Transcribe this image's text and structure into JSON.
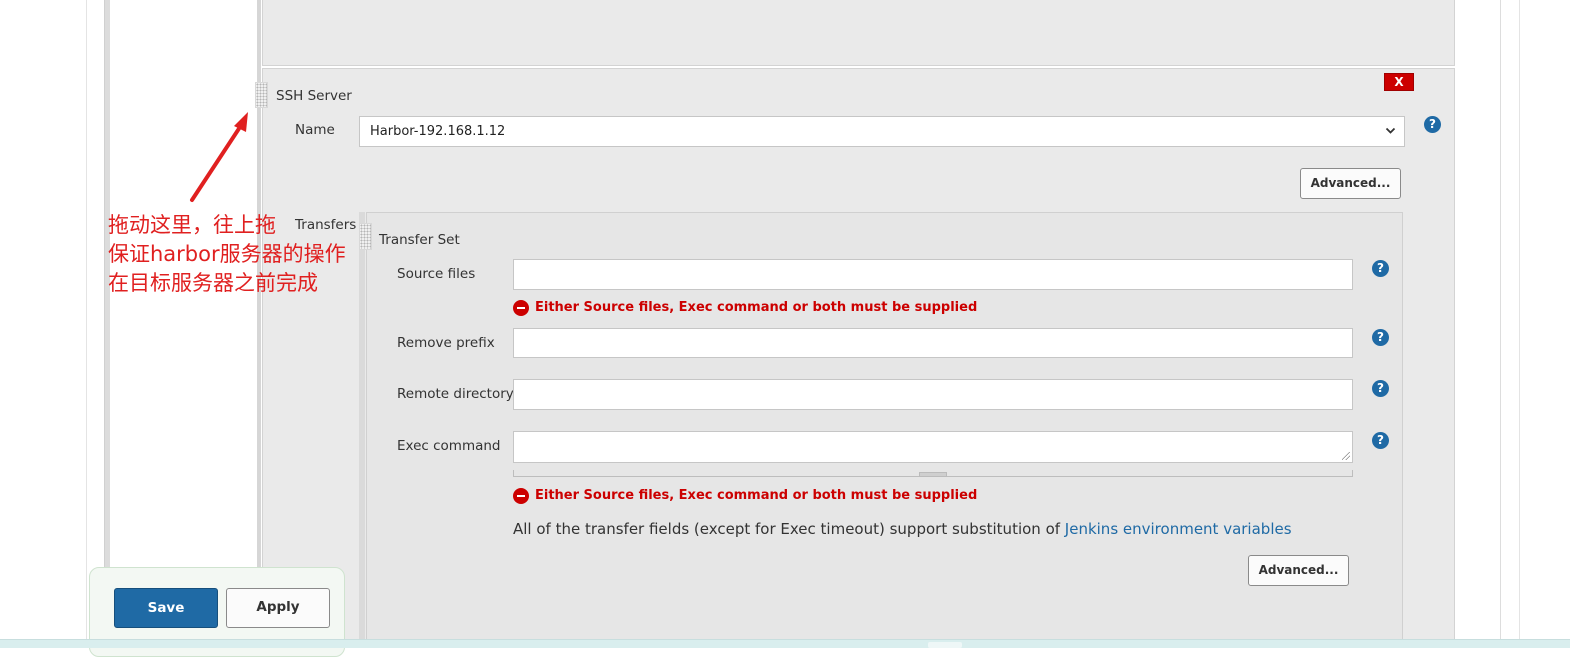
{
  "ssh_server": {
    "section_label": "SSH Server",
    "delete_label": "X",
    "name_label": "Name",
    "name_value": "Harbor-192.168.1.12",
    "advanced_label": "Advanced..."
  },
  "transfers": {
    "label": "Transfers",
    "transfer_set_label": "Transfer Set",
    "source_files_label": "Source files",
    "source_files_value": "",
    "remove_prefix_label": "Remove prefix",
    "remove_prefix_value": "",
    "remote_directory_label": "Remote directory",
    "remote_directory_value": "",
    "exec_command_label": "Exec command",
    "exec_command_value": "",
    "error_message": "Either Source files, Exec command or both must be supplied",
    "note_text": "All of the transfer fields (except for Exec timeout) support substitution of ",
    "note_link": "Jenkins environment variables",
    "advanced_label": "Advanced..."
  },
  "actions": {
    "save_label": "Save",
    "apply_label": "Apply"
  },
  "annotation": {
    "line1": "拖动这里，往上拖",
    "line2": "保证harbor服务器的操作",
    "line3": "在目标服务器之前完成",
    "color": "#e02020"
  },
  "colors": {
    "accent": "#1f6aa5",
    "error": "#cc0000",
    "panel": "#eaeaea"
  },
  "icons": {
    "help": "question-mark-icon",
    "error": "error-minus-icon",
    "drag": "drag-handle-icon"
  }
}
